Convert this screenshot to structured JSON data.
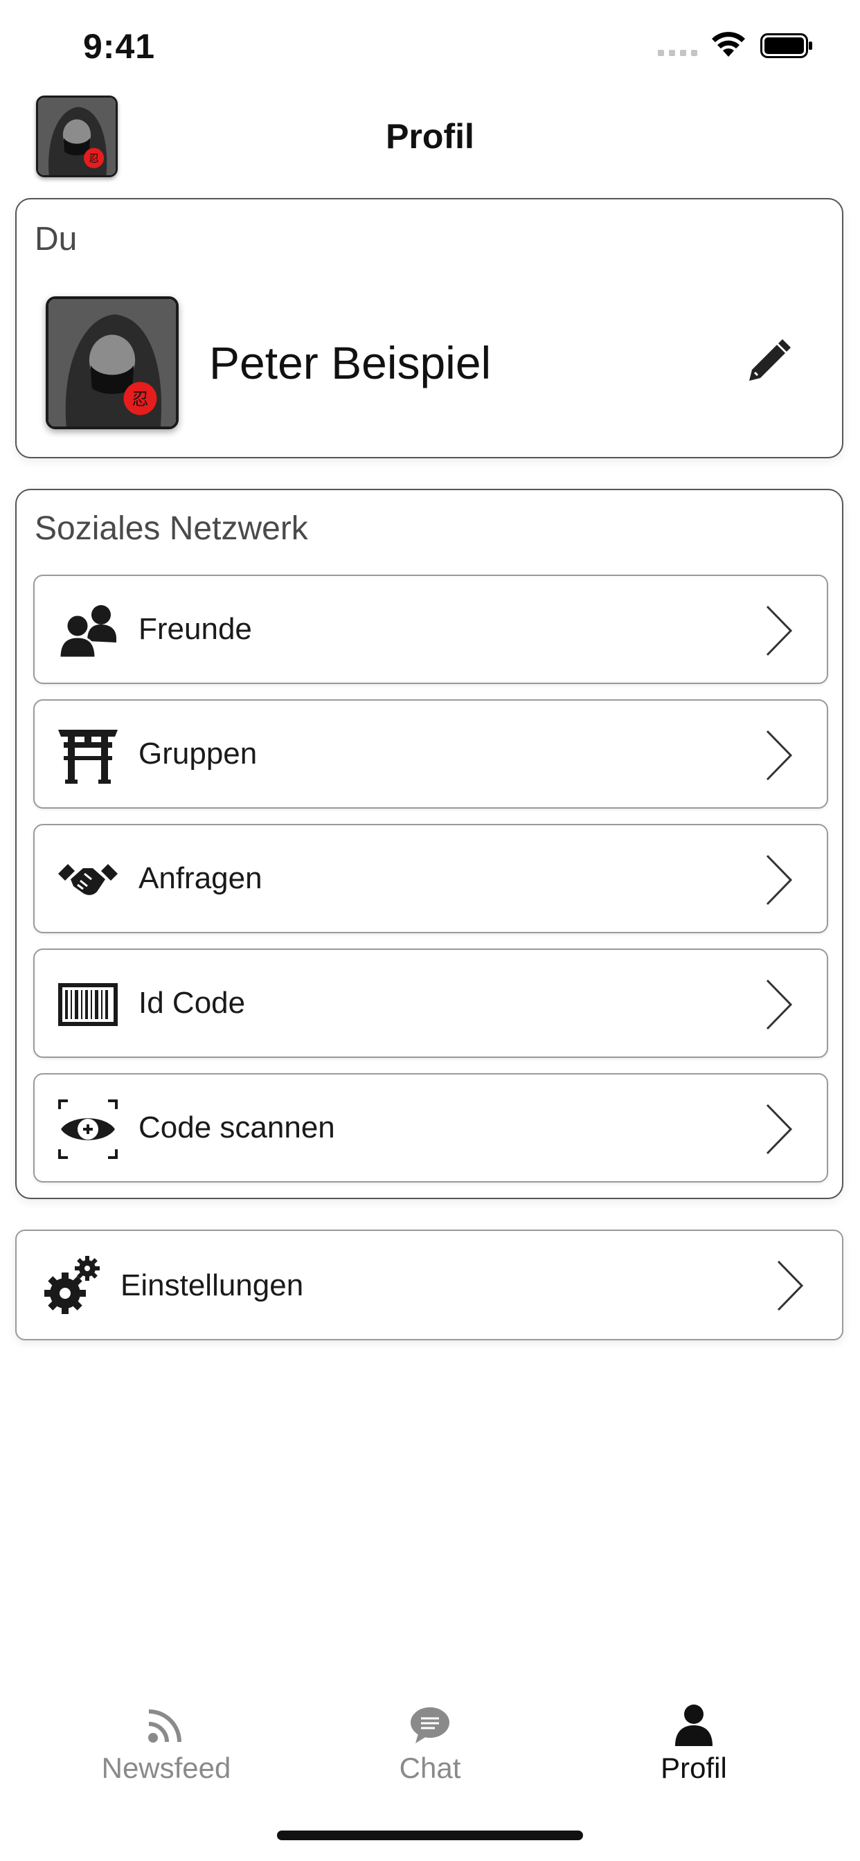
{
  "status_bar": {
    "time": "9:41"
  },
  "header": {
    "title": "Profil"
  },
  "profile_card": {
    "section_title": "Du",
    "name": "Peter Beispiel"
  },
  "social_card": {
    "section_title": "Soziales Netzwerk",
    "items": [
      {
        "label": "Freunde",
        "icon": "friends-icon"
      },
      {
        "label": "Gruppen",
        "icon": "torii-gate-icon"
      },
      {
        "label": "Anfragen",
        "icon": "handshake-icon"
      },
      {
        "label": "Id Code",
        "icon": "barcode-icon"
      },
      {
        "label": "Code scannen",
        "icon": "scan-eye-icon"
      }
    ]
  },
  "settings": {
    "label": "Einstellungen",
    "icon": "gears-icon"
  },
  "tabs": [
    {
      "label": "Newsfeed",
      "icon": "rss-icon",
      "active": false
    },
    {
      "label": "Chat",
      "icon": "chat-bubble-icon",
      "active": false
    },
    {
      "label": "Profil",
      "icon": "person-icon",
      "active": true
    }
  ],
  "colors": {
    "active_tab": "#111111",
    "inactive_tab": "#8a8a8a",
    "border": "#555555"
  }
}
